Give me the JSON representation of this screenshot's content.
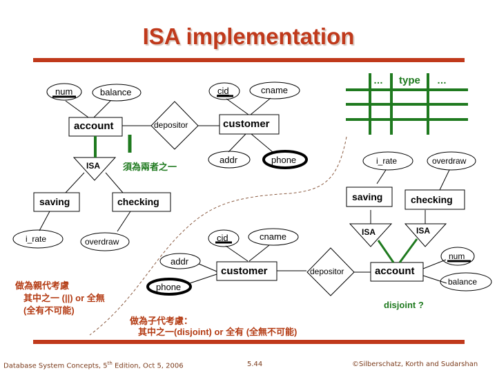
{
  "slide": {
    "title": "ISA implementation",
    "accent_color": "#c0391b",
    "green_color": "#1f7a1f"
  },
  "left_diagram": {
    "entity_account": "account",
    "attr_num": "num",
    "attr_balance": "balance",
    "relationship": "depositor",
    "isa": "ISA",
    "note_total": "須為兩者之一",
    "entity_saving": "saving",
    "entity_checking": "checking",
    "attr_i_rate": "i_rate",
    "attr_overdraw": "overdraw"
  },
  "top_customer": {
    "entity": "customer",
    "attr_cid": "cid",
    "attr_cname": "cname",
    "attr_addr": "addr",
    "attr_phone": "phone"
  },
  "table_sketch": {
    "headers": [
      "…",
      "type",
      "…"
    ]
  },
  "right_diagram": {
    "attr_i_rate": "i_rate",
    "attr_overdraw": "overdraw",
    "entity_saving": "saving",
    "entity_checking": "checking",
    "isa_left": "ISA",
    "isa_right": "ISA",
    "entity_account": "account",
    "attr_num": "num",
    "attr_balance": "balance",
    "note_disjoint": "disjoint ?"
  },
  "bottom_customer": {
    "entity": "customer",
    "attr_cid": "cid",
    "attr_cname": "cname",
    "attr_addr": "addr",
    "attr_phone": "phone",
    "relationship": "depositor"
  },
  "notes": {
    "parent_line1": "做為親代考慮",
    "parent_line2": "其中之一 (||) or 全無",
    "parent_line3": "(全有不可能)",
    "child_line1": "做為子代考慮：",
    "child_line2": "其中之一(disjoint) or 全有 (全無不可能)"
  },
  "footer": {
    "left_prefix": "Database System Concepts, 5",
    "left_sup": "th",
    "left_suffix": " Edition, Oct 5, 2006",
    "center": "5.44",
    "right": "©Silberschatz, Korth and Sudarshan"
  }
}
